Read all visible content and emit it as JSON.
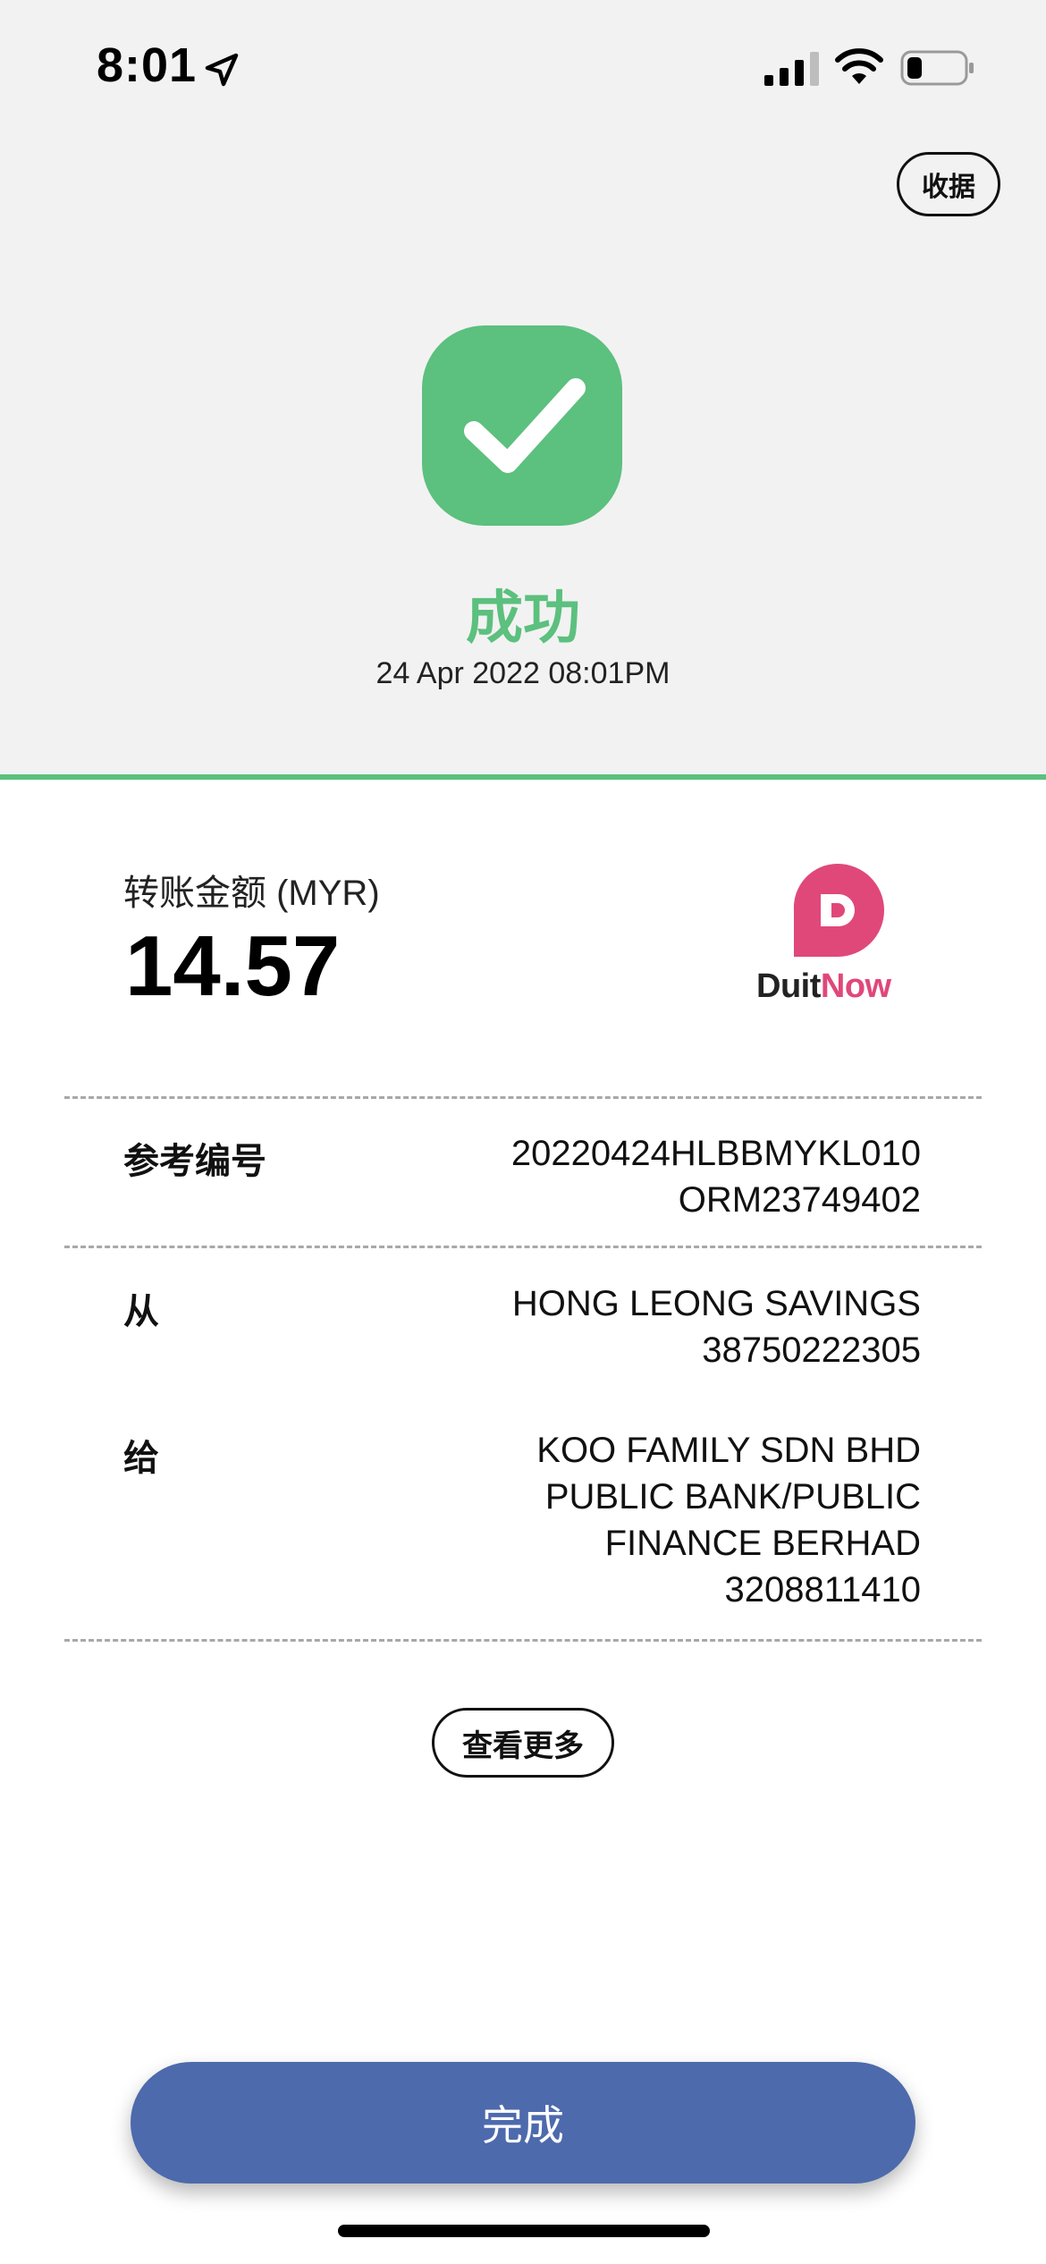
{
  "status_bar": {
    "time": "8:01",
    "location_icon": "location-arrow-icon",
    "signal_icon": "cellular-signal-icon",
    "wifi_icon": "wifi-icon",
    "battery_icon": "battery-icon"
  },
  "header": {
    "receipt_label": "收据"
  },
  "result": {
    "icon": "checkmark-icon",
    "title": "成功",
    "datetime": "24 Apr 2022 08:01PM"
  },
  "transfer": {
    "amount_label": "转账金额 (MYR)",
    "amount": "14.57",
    "logo_text_1": "Duit",
    "logo_text_2": "Now"
  },
  "details": [
    {
      "label": "参考编号",
      "lines": [
        "20220424HLBBMYKL010",
        "ORM23749402"
      ]
    },
    {
      "label": "从",
      "lines": [
        "HONG LEONG SAVINGS",
        "38750222305"
      ]
    },
    {
      "label": "给",
      "lines": [
        "KOO FAMILY SDN BHD",
        "PUBLIC BANK/PUBLIC",
        "FINANCE BERHAD",
        "3208811410"
      ]
    }
  ],
  "actions": {
    "view_more": "查看更多",
    "done": "完成"
  },
  "colors": {
    "success_green": "#5cc07e",
    "primary_blue": "#4d6aad",
    "duitnow_pink": "#e0487a",
    "top_background": "#f2f2f2"
  }
}
